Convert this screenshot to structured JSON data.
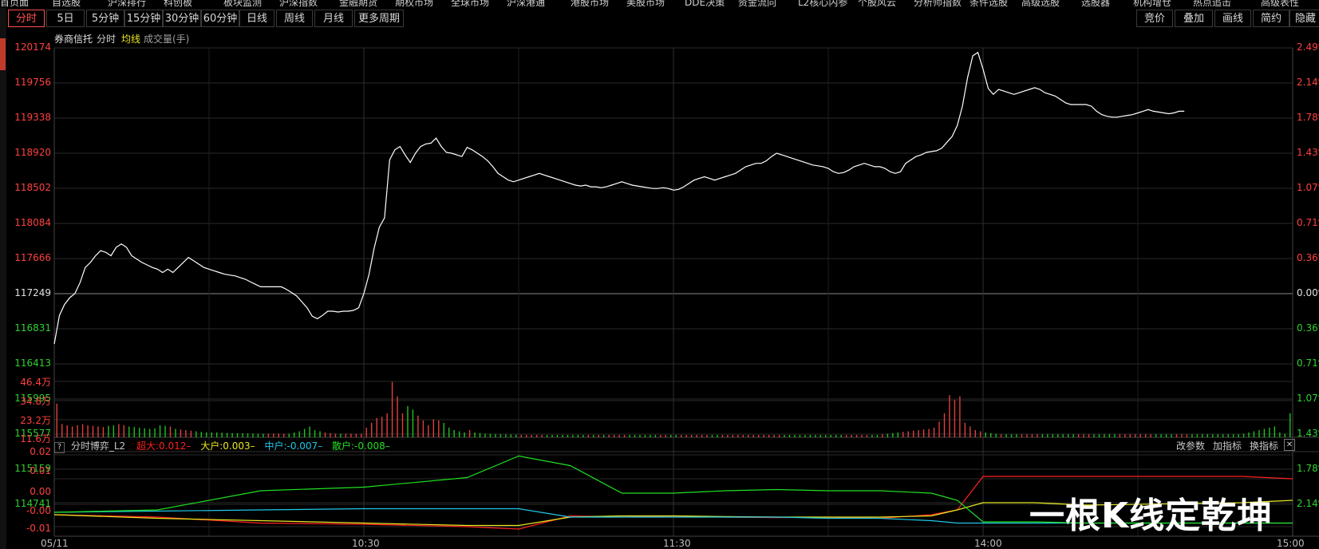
{
  "top_menu": [
    "首页面",
    "自选股",
    "沪深排行",
    "科创板",
    "板块监测",
    "沪深指数",
    "金融期货",
    "期权市场",
    "全球市场",
    "沪深港通",
    "港股市场",
    "美股市场",
    "DDE决策",
    "资金流向",
    "L2核心内参",
    "个股风云",
    "分析师指数",
    "条件选股",
    "高级选股",
    "选股器",
    "机构增仓",
    "热点追击",
    "高级表性"
  ],
  "period_tabs": [
    "分时",
    "5日",
    "5分钟",
    "15分钟",
    "30分钟",
    "60分钟",
    "日线",
    "周线",
    "月线",
    "更多周期"
  ],
  "right_tabs": [
    "竞价",
    "叠加",
    "画线",
    "简约",
    "隐藏"
  ],
  "info": {
    "name": "券商信托",
    "fenshi": "分时",
    "avg_label": "均线",
    "vol_label": "成交量(手)"
  },
  "price_axis": {
    "left_up": [
      "120174",
      "119756",
      "119338",
      "118920",
      "118502",
      "118084",
      "117666"
    ],
    "base": "117249",
    "left_down": [
      "116831",
      "116413",
      "115995",
      "115577",
      "115159",
      "114741"
    ],
    "right_up": [
      "2.49%",
      "2.14%",
      "1.78%",
      "1.43%",
      "1.07%",
      "0.71%",
      "0.36%"
    ],
    "right_base": "0.00%",
    "right_down": [
      "0.36%",
      "0.71%",
      "1.07%",
      "1.43%",
      "1.78%",
      "2.14%"
    ]
  },
  "volume_axis": [
    "46.4万",
    "34.8万",
    "23.2万",
    "11.6万"
  ],
  "indicator": {
    "help": "?",
    "name": "分时博弈_L2",
    "super": "超大:0.012",
    "big": "大户:0.003",
    "mid": "中户:-0.007",
    "small": "散户:-0.008",
    "btn_params": "改参数",
    "btn_add": "加指标",
    "btn_switch": "换指标",
    "close": "✕",
    "axis": [
      "0.02",
      "0.01",
      "0.00",
      "-0.00",
      "-0.01"
    ]
  },
  "time_axis": [
    "05/11",
    "10:30",
    "11:30",
    "14:00",
    "15:00"
  ],
  "watermark": "一根K线定乾坤",
  "colors": {
    "up": "#ff3030",
    "down": "#20d020",
    "price": "#ffffff",
    "super": "#ff2020",
    "big": "#e8e820",
    "mid": "#20c8e8",
    "small": "#20e020",
    "grid": "#2a2a2a"
  },
  "chart_data": [
    {
      "type": "line",
      "title": "券商信托 分时",
      "ylim": [
        114323,
        120174
      ],
      "base": 117249,
      "x_range": [
        0,
        240
      ],
      "series": [
        {
          "name": "price",
          "values": [
            116650,
            116990,
            117120,
            117200,
            117250,
            117380,
            117560,
            117620,
            117700,
            117760,
            117740,
            117700,
            117800,
            117840,
            117800,
            117700,
            117660,
            117620,
            117590,
            117560,
            117540,
            117500,
            117540,
            117500,
            117560,
            117620,
            117680,
            117640,
            117600,
            117560,
            117540,
            117520,
            117500,
            117480,
            117470,
            117460,
            117440,
            117420,
            117390,
            117360,
            117330,
            117330,
            117330,
            117330,
            117330,
            117300,
            117260,
            117220,
            117150,
            117080,
            116980,
            116950,
            116990,
            117040,
            117040,
            117030,
            117040,
            117040,
            117050,
            117080,
            117250,
            117480,
            117790,
            118040,
            118150,
            118840,
            118960,
            119000,
            118900,
            118810,
            118920,
            119000,
            119030,
            119040,
            119100,
            119000,
            118930,
            118920,
            118900,
            118880,
            118990,
            118960,
            118920,
            118880,
            118830,
            118760,
            118680,
            118640,
            118600,
            118580,
            118600,
            118620,
            118640,
            118660,
            118680,
            118660,
            118640,
            118620,
            118600,
            118580,
            118560,
            118540,
            118530,
            118540,
            118520,
            118520,
            118510,
            118520,
            118540,
            118560,
            118580,
            118560,
            118540,
            118530,
            118520,
            118510,
            118500,
            118500,
            118510,
            118500,
            118480,
            118490,
            118520,
            118560,
            118600,
            118620,
            118640,
            118620,
            118600,
            118620,
            118640,
            118660,
            118680,
            118720,
            118760,
            118780,
            118800,
            118800,
            118830,
            118880,
            118920,
            118900,
            118880,
            118860,
            118840,
            118820,
            118800,
            118780,
            118770,
            118760,
            118740,
            118700,
            118680,
            118690,
            118720,
            118760,
            118780,
            118800,
            118780,
            118760,
            118760,
            118740,
            118700,
            118680,
            118700,
            118800,
            118840,
            118880,
            118900,
            118930,
            118940,
            118950,
            118980,
            119050,
            119120,
            119250,
            119480,
            119820,
            120080,
            120120,
            119920,
            119690,
            119620,
            119680,
            119660,
            119640,
            119620,
            119640,
            119660,
            119680,
            119700,
            119680,
            119640,
            119620,
            119600,
            119560,
            119520,
            119500,
            119500,
            119500,
            119500,
            119480,
            119420,
            119380,
            119360,
            119350,
            119350,
            119360,
            119370,
            119380,
            119400,
            119420,
            119440,
            119420,
            119410,
            119400,
            119390,
            119400,
            119420,
            119420
          ]
        }
      ]
    },
    {
      "type": "bar",
      "title": "成交量",
      "ylim": [
        0,
        464000
      ],
      "x_range": [
        0,
        240
      ],
      "series": [
        {
          "name": "volume",
          "values": [
            280000,
            110000,
            100000,
            90000,
            100000,
            110000,
            100000,
            95000,
            90000,
            85000,
            95000,
            100000,
            110000,
            100000,
            90000,
            85000,
            80000,
            75000,
            70000,
            75000,
            100000,
            95000,
            90000,
            70000,
            65000,
            60000,
            55000,
            50000,
            45000,
            40000,
            40000,
            40000,
            38000,
            36000,
            35000,
            34000,
            33000,
            32000,
            31000,
            30000,
            30000,
            30000,
            30000,
            30000,
            30000,
            30000,
            40000,
            50000,
            70000,
            90000,
            60000,
            50000,
            40000,
            35000,
            30000,
            30000,
            30000,
            30000,
            30000,
            30000,
            80000,
            120000,
            160000,
            170000,
            200000,
            460000,
            340000,
            200000,
            260000,
            230000,
            180000,
            140000,
            100000,
            150000,
            140000,
            120000,
            80000,
            60000,
            50000,
            40000,
            60000,
            40000,
            35000,
            30000,
            28000,
            26000,
            25000,
            24000,
            23000,
            22000,
            21000,
            20000,
            20000,
            20000,
            20000,
            20000,
            20000,
            20000,
            20000,
            20000,
            20000,
            20000,
            20000,
            20000,
            20000,
            20000,
            20000,
            20000,
            20000,
            20000,
            20000,
            20000,
            20000,
            20000,
            20000,
            20000,
            20000,
            20000,
            20000,
            20000,
            20000,
            20000,
            20000,
            20000,
            20000,
            20000,
            20000,
            20000,
            20000,
            20000,
            20000,
            20000,
            20000,
            20000,
            20000,
            20000,
            20000,
            20000,
            20000,
            20000,
            20000,
            20000,
            20000,
            20000,
            20000,
            20000,
            20000,
            20000,
            20000,
            20000,
            20000,
            20000,
            20000,
            20000,
            20000,
            20000,
            20000,
            20000,
            20000,
            20000,
            25000,
            30000,
            35000,
            40000,
            45000,
            50000,
            55000,
            60000,
            65000,
            70000,
            80000,
            130000,
            200000,
            350000,
            310000,
            340000,
            120000,
            90000,
            60000,
            50000,
            40000,
            35000,
            30000,
            25000,
            25000,
            25000,
            25000,
            25000,
            25000,
            25000,
            25000,
            25000,
            25000,
            25000,
            25000,
            25000,
            25000,
            25000,
            25000,
            25000,
            25000,
            25000,
            25000,
            25000,
            25000,
            25000,
            25000,
            25000,
            25000,
            25000,
            25000,
            25000,
            25000,
            25000,
            25000,
            25000,
            25000,
            25000,
            25000,
            25000,
            25000,
            25000,
            25000,
            25000,
            25000,
            25000,
            25000,
            25000,
            25000,
            25000,
            30000,
            40000,
            50000,
            60000,
            70000,
            80000,
            90000,
            40000,
            30000,
            200000
          ]
        }
      ]
    },
    {
      "type": "line",
      "title": "分时博弈_L2",
      "ylim": [
        -0.011,
        0.021
      ],
      "x_range": [
        0,
        240
      ],
      "series": [
        {
          "name": "超大",
          "x": [
            0,
            20,
            40,
            60,
            80,
            90,
            100,
            110,
            120,
            130,
            140,
            150,
            160,
            170,
            175,
            180,
            190,
            200,
            230,
            240
          ],
          "values": [
            -0.005,
            -0.006,
            -0.0085,
            -0.009,
            -0.01,
            -0.011,
            -0.0055,
            -0.006,
            -0.0055,
            -0.006,
            -0.0062,
            -0.006,
            -0.0065,
            -0.005,
            -0.003,
            0.011,
            0.011,
            0.011,
            0.011,
            0.01
          ]
        },
        {
          "name": "大户",
          "x": [
            0,
            20,
            40,
            60,
            80,
            90,
            100,
            110,
            120,
            130,
            140,
            150,
            160,
            170,
            175,
            180,
            190,
            200,
            230,
            240
          ],
          "values": [
            -0.005,
            -0.0065,
            -0.0075,
            -0.0085,
            -0.0095,
            -0.0095,
            -0.006,
            -0.0055,
            -0.0055,
            -0.0058,
            -0.006,
            -0.006,
            -0.006,
            -0.0055,
            -0.003,
            0.0,
            0.0,
            -0.001,
            0.0,
            0.001
          ]
        },
        {
          "name": "中户",
          "x": [
            0,
            20,
            40,
            60,
            80,
            90,
            100,
            110,
            120,
            130,
            140,
            150,
            160,
            170,
            175,
            180,
            190,
            200,
            230,
            240
          ],
          "values": [
            -0.004,
            -0.0035,
            -0.003,
            -0.0025,
            -0.0025,
            -0.0025,
            -0.006,
            -0.006,
            -0.006,
            -0.006,
            -0.006,
            -0.0065,
            -0.0065,
            -0.0075,
            -0.0085,
            -0.0085,
            -0.0085,
            -0.0085,
            -0.0085,
            -0.0085
          ]
        },
        {
          "name": "散户",
          "x": [
            0,
            20,
            40,
            60,
            80,
            90,
            100,
            110,
            120,
            130,
            140,
            150,
            160,
            170,
            175,
            180,
            190,
            200,
            230,
            240
          ],
          "values": [
            -0.004,
            -0.003,
            0.005,
            0.0065,
            0.0105,
            0.0195,
            0.0155,
            0.004,
            0.004,
            0.005,
            0.0055,
            0.005,
            0.005,
            0.004,
            0.001,
            -0.008,
            -0.008,
            -0.0085,
            -0.0085,
            -0.0085
          ]
        }
      ]
    }
  ]
}
